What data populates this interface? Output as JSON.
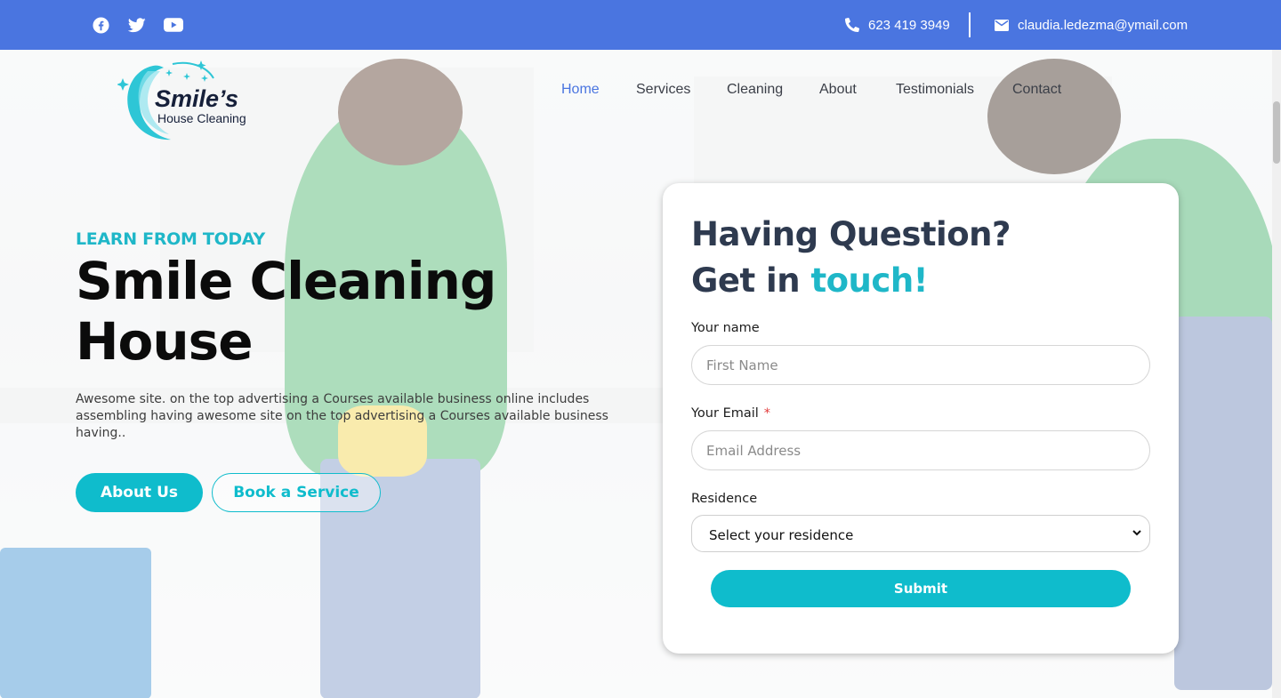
{
  "topbar": {
    "social": [
      "facebook-icon",
      "twitter-icon",
      "youtube-icon"
    ],
    "phone": "623 419 3949",
    "email": "claudia.ledezma@ymail.com",
    "bg_color": "#4a75e0"
  },
  "logo": {
    "title": "Smile’s",
    "subtitle": "House Cleaning"
  },
  "nav": {
    "items": [
      {
        "label": "Home",
        "active": true
      },
      {
        "label": "Services",
        "active": false
      },
      {
        "label": "Cleaning",
        "active": false
      },
      {
        "label": "About",
        "active": false
      },
      {
        "label": "Testimonials",
        "active": false
      },
      {
        "label": "Contact",
        "active": false
      }
    ]
  },
  "hero": {
    "eyebrow": "LEARN FROM TODAY",
    "headline_line1": "Smile Cleaning",
    "headline_line2": "House",
    "description": "Awesome site. on the top advertising a Courses available business online includes assembling having awesome site on the top advertising a Courses available business having..",
    "btn_primary": "About Us",
    "btn_secondary": "Book a Service",
    "accent_color": "#0fbccc"
  },
  "form": {
    "heading_line1": "Having Question?",
    "heading_line2_prefix": "Get in",
    "heading_line2_accent": "touch!",
    "name_label": "Your name",
    "name_placeholder": "First Name",
    "email_label": "Your Email",
    "email_required_mark": "*",
    "email_placeholder": "Email Address",
    "residence_label": "Residence",
    "residence_selected": "Select your residence",
    "submit_label": "Submit"
  }
}
